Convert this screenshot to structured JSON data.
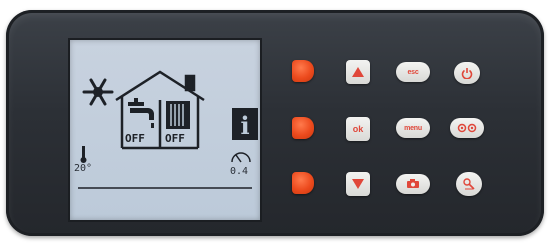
{
  "display": {
    "heating_status": "OFF",
    "radiator_status": "OFF",
    "temperature_reading": "20°",
    "gauge_reading": "0.4"
  },
  "keypad": {
    "ok_label": "ok",
    "esc_label": "esc",
    "menu_label": "menu"
  },
  "icons": {
    "snowflake": "snowflake-icon",
    "house": "house-icon",
    "tap": "tap-icon",
    "radiator": "radiator-icon",
    "info": "info-icon",
    "thermometer": "thermometer-icon",
    "gauge": "gauge-icon",
    "power": "power-icon"
  },
  "colors": {
    "bezel": "#2c3036",
    "screen": "#c4cfdc",
    "accent_red": "#ec4a1d",
    "button_white": "#ececea",
    "label_red": "#e0473a"
  }
}
